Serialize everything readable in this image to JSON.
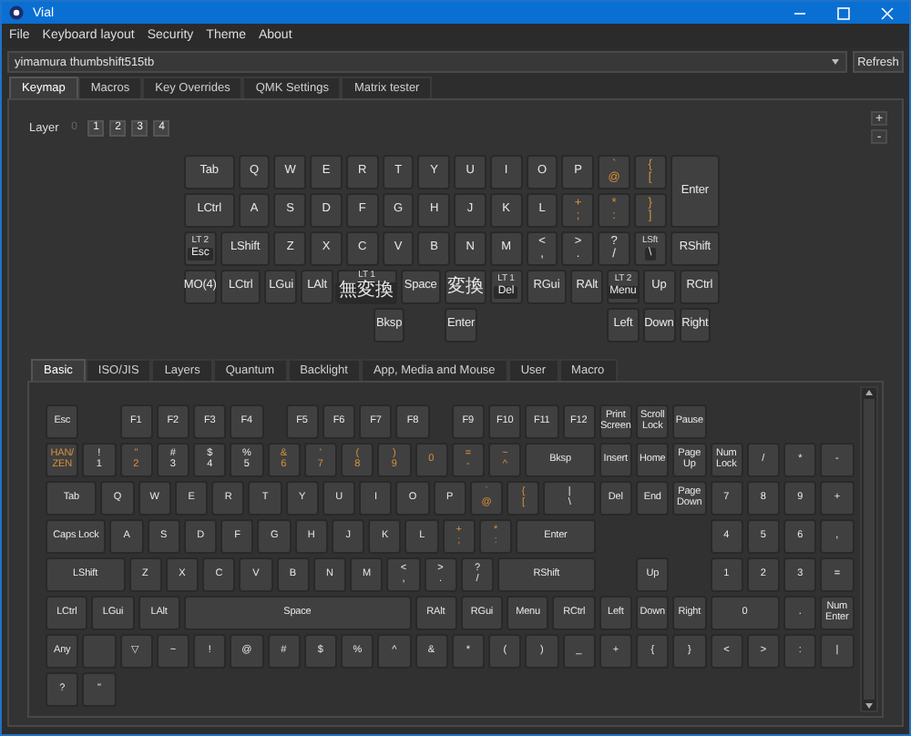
{
  "window": {
    "title": "Vial"
  },
  "menu": [
    "File",
    "Keyboard layout",
    "Security",
    "Theme",
    "About"
  ],
  "device": {
    "value": "yimamura thumbshift515tb",
    "button": "Refresh"
  },
  "tabs": [
    {
      "label": "Keymap",
      "selected": true
    },
    {
      "label": "Macros",
      "selected": false
    },
    {
      "label": "Key Overrides",
      "selected": false
    },
    {
      "label": "QMK Settings",
      "selected": false
    },
    {
      "label": "Matrix tester",
      "selected": false
    }
  ],
  "layers": {
    "label": "Layer",
    "buttons": [
      {
        "label": "0",
        "selected": true
      },
      {
        "label": "1",
        "selected": false
      },
      {
        "label": "2",
        "selected": false
      },
      {
        "label": "3",
        "selected": false
      },
      {
        "label": "4",
        "selected": false
      }
    ],
    "zoom": [
      "+",
      "-"
    ]
  },
  "keymap": {
    "key_rows": [
      {
        "keys": [
          {
            "kind": "key",
            "label": "Tab"
          },
          {
            "kind": "key",
            "label": "Q"
          },
          {
            "kind": "key",
            "label": "W"
          },
          {
            "kind": "key",
            "label": "E"
          },
          {
            "kind": "key",
            "label": "R"
          },
          {
            "kind": "key",
            "label": "T"
          },
          {
            "kind": "key",
            "label": "Y"
          },
          {
            "kind": "key",
            "label": "U"
          },
          {
            "kind": "key",
            "label": "I"
          },
          {
            "kind": "key",
            "label": "O"
          },
          {
            "kind": "key",
            "label": "P"
          },
          {
            "kind": "jis",
            "top": "`",
            "label": "@"
          },
          {
            "kind": "jis",
            "top": "{",
            "label": "["
          },
          {
            "kind": "key",
            "label": "Enter"
          }
        ]
      },
      {
        "keys": [
          {
            "kind": "key",
            "label": "LCtrl"
          },
          {
            "kind": "key",
            "label": "A"
          },
          {
            "kind": "key",
            "label": "S"
          },
          {
            "kind": "key",
            "label": "D"
          },
          {
            "kind": "key",
            "label": "F"
          },
          {
            "kind": "key",
            "label": "G"
          },
          {
            "kind": "key",
            "label": "H"
          },
          {
            "kind": "key",
            "label": "J"
          },
          {
            "kind": "key",
            "label": "K"
          },
          {
            "kind": "key",
            "label": "L"
          },
          {
            "kind": "jis",
            "top": "+",
            "label": ";"
          },
          {
            "kind": "jis",
            "top": "*",
            "label": ":"
          },
          {
            "kind": "jis",
            "top": "}",
            "label": "]"
          }
        ]
      },
      {
        "keys": [
          {
            "kind": "layer",
            "top": "LT 2",
            "label": "Esc"
          },
          {
            "kind": "key",
            "label": "LShift"
          },
          {
            "kind": "key",
            "label": "Z"
          },
          {
            "kind": "key",
            "label": "X"
          },
          {
            "kind": "key",
            "label": "C"
          },
          {
            "kind": "key",
            "label": "V"
          },
          {
            "kind": "key",
            "label": "B"
          },
          {
            "kind": "key",
            "label": "N"
          },
          {
            "kind": "key",
            "label": "M"
          },
          {
            "kind": "key",
            "top": "<",
            "label": ","
          },
          {
            "kind": "key",
            "top": ">",
            "label": "."
          },
          {
            "kind": "key",
            "top": "?",
            "label": "/"
          },
          {
            "kind": "layer",
            "top": "LSft",
            "label": "\\"
          },
          {
            "kind": "key",
            "label": "RShift"
          }
        ]
      },
      {
        "keys": [
          {
            "kind": "key",
            "label": "MO(4)"
          },
          {
            "kind": "key",
            "label": "LCtrl"
          },
          {
            "kind": "key",
            "label": "LGui"
          },
          {
            "kind": "key",
            "label": "LAlt"
          },
          {
            "kind": "layer",
            "top": "LT 1",
            "label": "無変換"
          },
          {
            "kind": "key",
            "label": "Space"
          },
          {
            "kind": "key",
            "label": "変換"
          },
          {
            "kind": "layer",
            "top": "LT 1",
            "label": "Del"
          },
          {
            "kind": "key",
            "label": "RGui"
          },
          {
            "kind": "key",
            "label": "RAlt"
          },
          {
            "kind": "layer",
            "top": "LT 2",
            "label": "Menu"
          },
          {
            "kind": "key",
            "label": "Up"
          },
          {
            "kind": "key",
            "label": "RCtrl"
          }
        ]
      },
      {
        "keys": [
          {
            "kind": "key",
            "label": "Bksp"
          },
          {
            "kind": "key",
            "label": "Enter"
          },
          {
            "kind": "key",
            "label": "Left"
          },
          {
            "kind": "key",
            "label": "Down"
          },
          {
            "kind": "key",
            "label": "Right"
          }
        ]
      }
    ]
  },
  "chooser": {
    "tabs": [
      {
        "label": "Basic",
        "selected": true
      },
      {
        "label": "ISO/JIS",
        "selected": false
      },
      {
        "label": "Layers",
        "selected": false
      },
      {
        "label": "Quantum",
        "selected": false
      },
      {
        "label": "Backlight",
        "selected": false
      },
      {
        "label": "App, Media and Mouse",
        "selected": false
      },
      {
        "label": "User",
        "selected": false
      },
      {
        "label": "Macro",
        "selected": false
      }
    ],
    "key_rows": [
      {
        "keys": [
          {
            "kind": "key",
            "label": "Esc"
          },
          {
            "kind": "key",
            "label": "F1"
          },
          {
            "kind": "key",
            "label": "F2"
          },
          {
            "kind": "key",
            "label": "F3"
          },
          {
            "kind": "key",
            "label": "F4"
          },
          {
            "kind": "key",
            "label": "F5"
          },
          {
            "kind": "key",
            "label": "F6"
          },
          {
            "kind": "key",
            "label": "F7"
          },
          {
            "kind": "key",
            "label": "F8"
          },
          {
            "kind": "key",
            "label": "F9"
          },
          {
            "kind": "key",
            "label": "F10"
          },
          {
            "kind": "key",
            "label": "F11"
          },
          {
            "kind": "key",
            "label": "F12"
          },
          {
            "kind": "key",
            "label": "Print Screen"
          },
          {
            "kind": "key",
            "label": "Scroll Lock"
          },
          {
            "kind": "key",
            "label": "Pause"
          }
        ]
      },
      {
        "keys": [
          {
            "kind": "jis",
            "label": "HAN/ ZEN"
          },
          {
            "kind": "key",
            "top": "!",
            "label": "1"
          },
          {
            "kind": "jis",
            "top": "\"",
            "label": "2"
          },
          {
            "kind": "key",
            "top": "#",
            "label": "3"
          },
          {
            "kind": "key",
            "top": "$",
            "label": "4"
          },
          {
            "kind": "key",
            "top": "%",
            "label": "5"
          },
          {
            "kind": "jis",
            "top": "&",
            "label": "6"
          },
          {
            "kind": "jis",
            "top": "'",
            "label": "7"
          },
          {
            "kind": "jis",
            "top": "(",
            "label": "8"
          },
          {
            "kind": "jis",
            "top": ")",
            "label": "9"
          },
          {
            "kind": "jis",
            "label": "0"
          },
          {
            "kind": "jis",
            "top": "=",
            "label": "-"
          },
          {
            "kind": "jis",
            "top": "~",
            "label": "^"
          },
          {
            "kind": "key",
            "label": "Bksp"
          },
          {
            "kind": "key",
            "label": "Insert"
          },
          {
            "kind": "key",
            "label": "Home"
          },
          {
            "kind": "key",
            "label": "Page Up"
          },
          {
            "kind": "key",
            "label": "Num Lock"
          },
          {
            "kind": "key",
            "label": "/"
          },
          {
            "kind": "key",
            "label": "*"
          },
          {
            "kind": "key",
            "label": "-"
          }
        ]
      },
      {
        "keys": [
          {
            "kind": "key",
            "label": "Tab"
          },
          {
            "kind": "key",
            "label": "Q"
          },
          {
            "kind": "key",
            "label": "W"
          },
          {
            "kind": "key",
            "label": "E"
          },
          {
            "kind": "key",
            "label": "R"
          },
          {
            "kind": "key",
            "label": "T"
          },
          {
            "kind": "key",
            "label": "Y"
          },
          {
            "kind": "key",
            "label": "U"
          },
          {
            "kind": "key",
            "label": "I"
          },
          {
            "kind": "key",
            "label": "O"
          },
          {
            "kind": "key",
            "label": "P"
          },
          {
            "kind": "jis",
            "top": "`",
            "label": "@"
          },
          {
            "kind": "jis",
            "top": "{",
            "label": "["
          },
          {
            "kind": "key",
            "top": "|",
            "label": "\\"
          },
          {
            "kind": "key",
            "label": "Del"
          },
          {
            "kind": "key",
            "label": "End"
          },
          {
            "kind": "key",
            "label": "Page Down"
          },
          {
            "kind": "key",
            "label": "7"
          },
          {
            "kind": "key",
            "label": "8"
          },
          {
            "kind": "key",
            "label": "9"
          },
          {
            "kind": "key",
            "label": "+"
          }
        ]
      },
      {
        "keys": [
          {
            "kind": "key",
            "label": "Caps Lock"
          },
          {
            "kind": "key",
            "label": "A"
          },
          {
            "kind": "key",
            "label": "S"
          },
          {
            "kind": "key",
            "label": "D"
          },
          {
            "kind": "key",
            "label": "F"
          },
          {
            "kind": "key",
            "label": "G"
          },
          {
            "kind": "key",
            "label": "H"
          },
          {
            "kind": "key",
            "label": "J"
          },
          {
            "kind": "key",
            "label": "K"
          },
          {
            "kind": "key",
            "label": "L"
          },
          {
            "kind": "jis",
            "top": "+",
            "label": ";"
          },
          {
            "kind": "jis",
            "top": "*",
            "label": ":"
          },
          {
            "kind": "key",
            "label": "Enter"
          },
          {
            "kind": "key",
            "label": "4"
          },
          {
            "kind": "key",
            "label": "5"
          },
          {
            "kind": "key",
            "label": "6"
          },
          {
            "kind": "key",
            "label": ","
          }
        ]
      },
      {
        "keys": [
          {
            "kind": "key",
            "label": "LShift"
          },
          {
            "kind": "key",
            "label": "Z"
          },
          {
            "kind": "key",
            "label": "X"
          },
          {
            "kind": "key",
            "label": "C"
          },
          {
            "kind": "key",
            "label": "V"
          },
          {
            "kind": "key",
            "label": "B"
          },
          {
            "kind": "key",
            "label": "N"
          },
          {
            "kind": "key",
            "label": "M"
          },
          {
            "kind": "key",
            "top": "<",
            "label": ","
          },
          {
            "kind": "key",
            "top": ">",
            "label": "."
          },
          {
            "kind": "key",
            "top": "?",
            "label": "/"
          },
          {
            "kind": "key",
            "label": "RShift"
          },
          {
            "kind": "key",
            "label": "Up"
          },
          {
            "kind": "key",
            "label": "1"
          },
          {
            "kind": "key",
            "label": "2"
          },
          {
            "kind": "key",
            "label": "3"
          },
          {
            "kind": "key",
            "label": "="
          }
        ]
      },
      {
        "keys": [
          {
            "kind": "key",
            "label": "LCtrl"
          },
          {
            "kind": "key",
            "label": "LGui"
          },
          {
            "kind": "key",
            "label": "LAlt"
          },
          {
            "kind": "key",
            "label": "Space"
          },
          {
            "kind": "key",
            "label": "RAlt"
          },
          {
            "kind": "key",
            "label": "RGui"
          },
          {
            "kind": "key",
            "label": "Menu"
          },
          {
            "kind": "key",
            "label": "RCtrl"
          },
          {
            "kind": "key",
            "label": "Left"
          },
          {
            "kind": "key",
            "label": "Down"
          },
          {
            "kind": "key",
            "label": "Right"
          },
          {
            "kind": "key",
            "label": "0"
          },
          {
            "kind": "key",
            "label": "."
          },
          {
            "kind": "key",
            "label": "Num Enter"
          }
        ]
      },
      {
        "keys": [
          {
            "kind": "key",
            "label": "Any"
          },
          {
            "kind": "blank"
          },
          {
            "kind": "key",
            "label": "▽"
          },
          {
            "kind": "key",
            "label": "~"
          },
          {
            "kind": "key",
            "label": "!"
          },
          {
            "kind": "key",
            "label": "@"
          },
          {
            "kind": "key",
            "label": "#"
          },
          {
            "kind": "key",
            "label": "$"
          },
          {
            "kind": "key",
            "label": "%"
          },
          {
            "kind": "key",
            "label": "^"
          },
          {
            "kind": "key",
            "label": "&"
          },
          {
            "kind": "key",
            "label": "*"
          },
          {
            "kind": "key",
            "label": "("
          },
          {
            "kind": "key",
            "label": ")"
          },
          {
            "kind": "key",
            "label": "_"
          },
          {
            "kind": "key",
            "label": "+"
          },
          {
            "kind": "key",
            "label": "{"
          },
          {
            "kind": "key",
            "label": "}"
          },
          {
            "kind": "key",
            "label": "<"
          },
          {
            "kind": "key",
            "label": ">"
          },
          {
            "kind": "key",
            "label": ":"
          },
          {
            "kind": "key",
            "label": "|"
          }
        ]
      },
      {
        "keys": [
          {
            "kind": "key",
            "label": "?"
          },
          {
            "kind": "key",
            "label": "\""
          }
        ]
      }
    ]
  }
}
